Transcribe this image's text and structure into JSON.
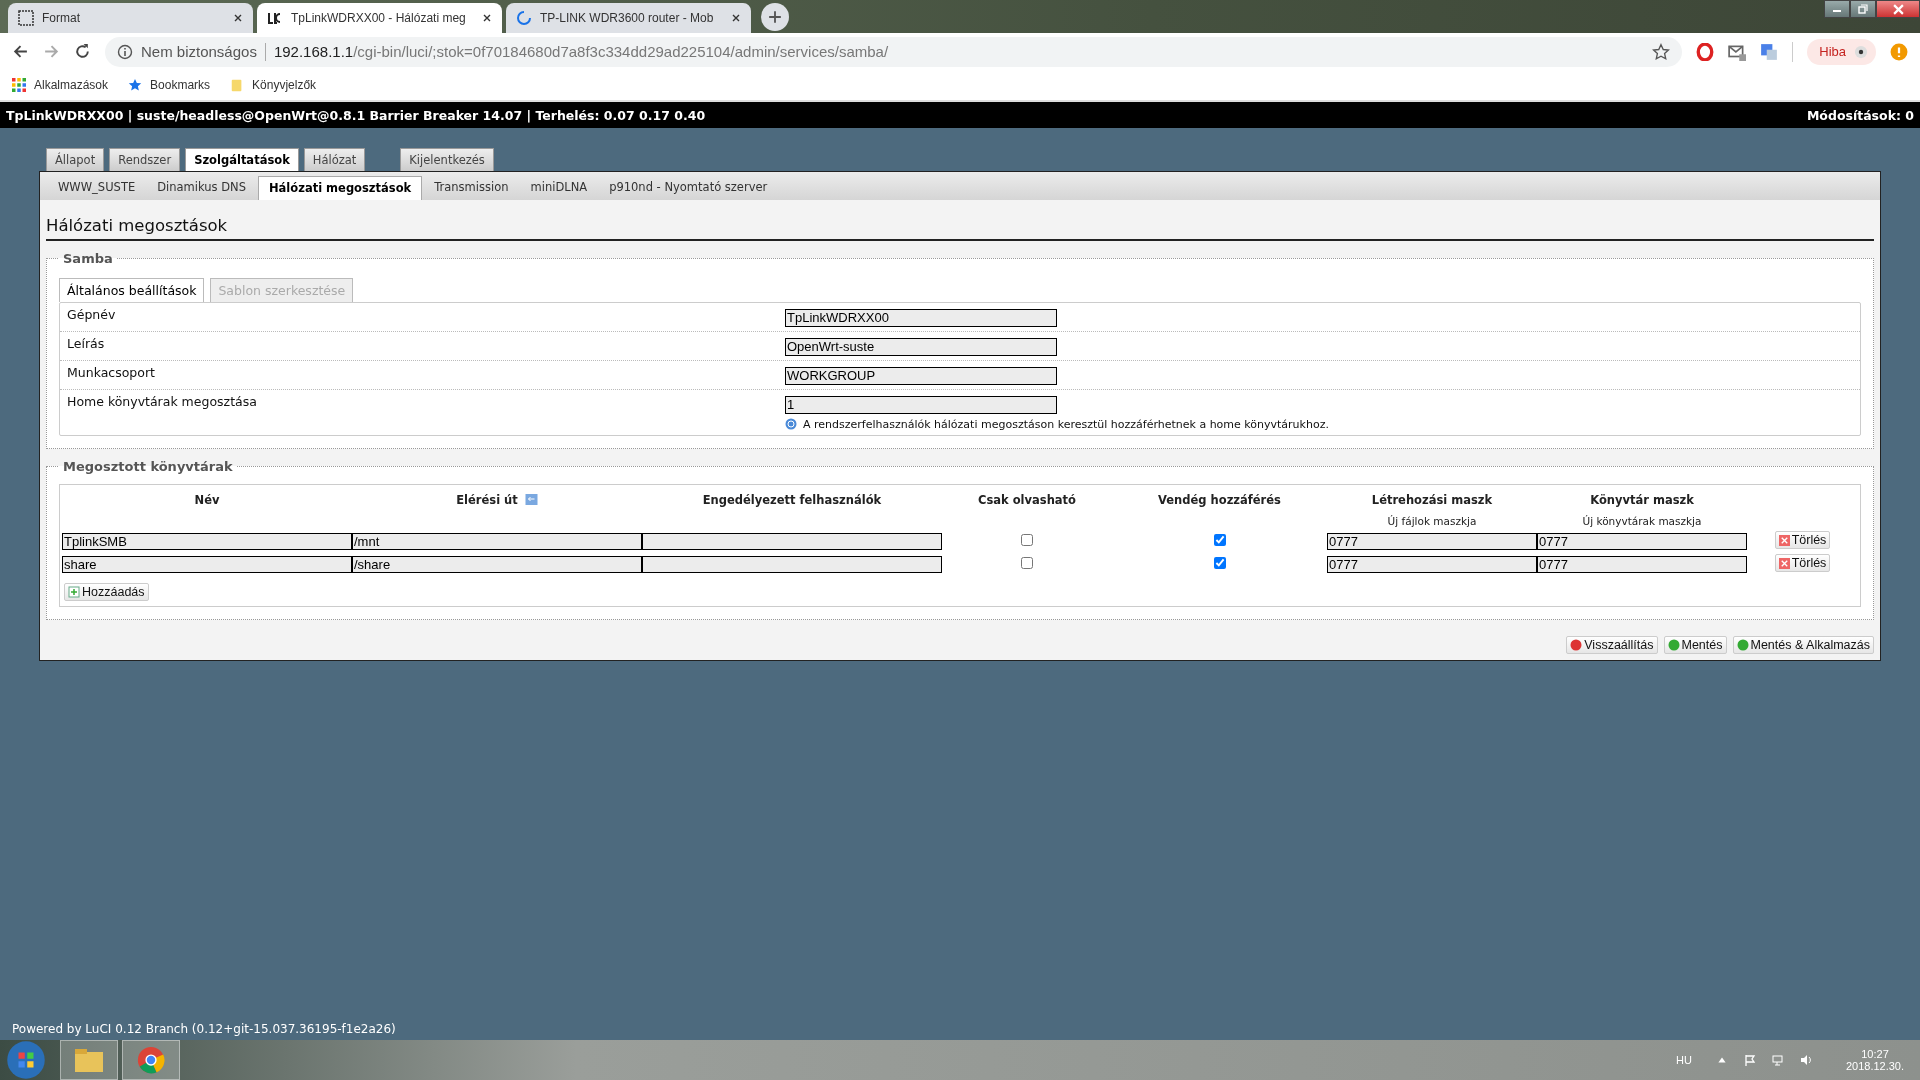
{
  "browser": {
    "tabs": [
      {
        "title": "Format",
        "selected": false
      },
      {
        "title": "TpLinkWDRXX00 - Hálózati meg",
        "selected": true
      },
      {
        "title": "TP-LINK WDR3600 router - Mob",
        "selected": false
      }
    ],
    "security_label": "Nem biztonságos",
    "url_host": "192.168.1.1",
    "url_path": "/cgi-bin/luci/;stok=0f70184680d7a8f3c334dd29ad225104/admin/services/samba/",
    "profile_label": "Hiba",
    "bookmarks": [
      {
        "label": "Alkalmazások"
      },
      {
        "label": "Bookmarks"
      },
      {
        "label": "Könyvjelzők"
      }
    ]
  },
  "header": {
    "title": "TpLinkWDRXX00 | suste/headless@OpenWrt@0.8.1 Barrier Breaker 14.07 | Terhelés: 0.07 0.17 0.40",
    "changes": "Módosítások: 0"
  },
  "main_tabs": [
    {
      "label": "Állapot",
      "selected": false
    },
    {
      "label": "Rendszer",
      "selected": false
    },
    {
      "label": "Szolgáltatások",
      "selected": true
    },
    {
      "label": "Hálózat",
      "selected": false
    },
    {
      "label": "Kijelentkezés",
      "selected": false
    }
  ],
  "sub_tabs": [
    {
      "label": "WWW_SUSTE",
      "selected": false
    },
    {
      "label": "Dinamikus DNS",
      "selected": false
    },
    {
      "label": "Hálózati megosztások",
      "selected": true
    },
    {
      "label": "Transmission",
      "selected": false
    },
    {
      "label": "miniDLNA",
      "selected": false
    },
    {
      "label": "p910nd - Nyomtató szerver",
      "selected": false
    }
  ],
  "page_title": "Hálózati megosztások",
  "samba": {
    "legend": "Samba",
    "tabs": [
      {
        "label": "Általános beállítások",
        "selected": true
      },
      {
        "label": "Sablon szerkesztése",
        "selected": false
      }
    ],
    "fields": [
      {
        "label": "Gépnév",
        "value": "TpLinkWDRXX00"
      },
      {
        "label": "Leírás",
        "value": "OpenWrt-suste"
      },
      {
        "label": "Munkacsoport",
        "value": "WORKGROUP"
      },
      {
        "label": "Home könyvtárak megosztása",
        "value": "1",
        "hint": "A rendszerfelhasználók hálózati megosztáson keresztül hozzáférhetnek a home könyvtárukhoz."
      }
    ]
  },
  "shares": {
    "legend": "Megosztott könyvtárak",
    "columns": [
      {
        "label": "Név"
      },
      {
        "label": "Elérési út"
      },
      {
        "label": "Engedélyezett felhasználók"
      },
      {
        "label": "Csak olvasható"
      },
      {
        "label": "Vendég hozzáférés"
      },
      {
        "label": "Létrehozási maszk",
        "sublabel": "Új fájlok maszkja"
      },
      {
        "label": "Könyvtár maszk",
        "sublabel": "Új könyvtárak maszkja"
      }
    ],
    "rows": [
      {
        "name": "TplinkSMB",
        "path": "/mnt",
        "users": "",
        "read_only": false,
        "guest": true,
        "create_mask": "0777",
        "dir_mask": "0777",
        "delete_label": "Törlés"
      },
      {
        "name": "share",
        "path": "/share",
        "users": "",
        "read_only": false,
        "guest": true,
        "create_mask": "0777",
        "dir_mask": "0777",
        "delete_label": "Törlés"
      }
    ],
    "add_label": "Hozzáadás"
  },
  "buttons": [
    {
      "label": "Visszaállítás",
      "kind": "reset"
    },
    {
      "label": "Mentés",
      "kind": "save"
    },
    {
      "label": "Mentés & Alkalmazás",
      "kind": "apply"
    }
  ],
  "footer": "Powered by LuCI 0.12 Branch (0.12+git-15.037.36195-f1e2a26)",
  "taskbar": {
    "language": "HU",
    "time": "10:27",
    "date": "2018.12.30."
  }
}
